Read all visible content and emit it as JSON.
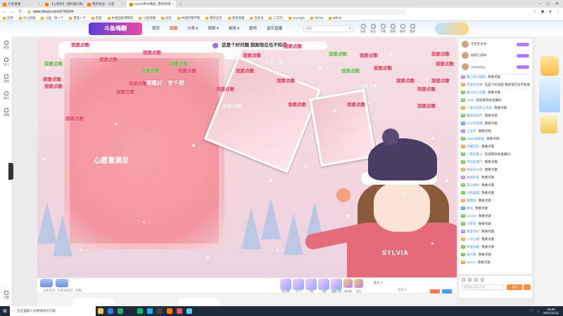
{
  "browser": {
    "tabs": [
      {
        "label": "斗鱼直播",
        "active": false
      },
      {
        "label": "【心愿单】(我的第1章)",
        "active": false
      },
      {
        "label": "我的关注 - 斗鱼",
        "active": false
      },
      {
        "label": "Sylvia希尔薇娅_我的频道",
        "active": true
      },
      {
        "label": "",
        "active": false
      }
    ],
    "url": "www.douyu.com/3742334",
    "bookmarks": [
      "应用",
      "九九金融",
      "斗鱼 - 每一个",
      "百度一下",
      "百度",
      "中国国家博物馆",
      "斗鱼直播",
      "抖音",
      "中国哔哩哔哩",
      "我的主页",
      "游戏直播",
      "已关注",
      "二次元",
      "YouTube",
      "TikTok",
      "Bilibili"
    ],
    "window_controls": [
      "–",
      "□",
      "✕"
    ]
  },
  "site": {
    "logo": "斗鱼嗨翻",
    "nav": [
      "首页",
      "直播",
      "分类 ▾",
      "视频 ▾",
      "游戏 ▾",
      "鱼吧",
      "音乐直播"
    ],
    "active_nav": "直播",
    "search_placeholder": "搜索",
    "header_icons": [
      "历史",
      "关注",
      "下载",
      "消息",
      "创作",
      "登录"
    ]
  },
  "sidebar": {
    "items": [
      "推荐",
      "关注",
      "游戏",
      "娱乐",
      "直播",
      "更多"
    ],
    "bottom": "设置"
  },
  "player": {
    "topic": "这是个好问题 我刚现在也不知道",
    "song": "嘟嘟好 - 李千郡",
    "card_text": "心愿意满足",
    "overlay_text": "SYLVIA"
  },
  "danmaku": [
    {
      "text": "我要点歌",
      "color": "red"
    },
    {
      "text": "我要点歌",
      "color": "red"
    },
    {
      "text": "我要点歌",
      "color": "red"
    },
    {
      "text": "我要点歌",
      "color": "red"
    },
    {
      "text": "我要点歌",
      "color": "green"
    },
    {
      "text": "我要点歌",
      "color": "red"
    },
    {
      "text": "我要点歌",
      "color": "red"
    },
    {
      "text": "我要点歌",
      "color": "red"
    },
    {
      "text": "我要点歌",
      "color": "red"
    },
    {
      "text": "我要点歌",
      "color": "green"
    },
    {
      "text": "我要点歌",
      "color": "red"
    },
    {
      "text": "我要点歌",
      "color": "red"
    },
    {
      "text": "我要点歌",
      "color": "red"
    },
    {
      "text": "我要点歌",
      "color": "green"
    },
    {
      "text": "我要点歌",
      "color": "red"
    },
    {
      "text": "我要点歌",
      "color": "red"
    },
    {
      "text": "我要点歌",
      "color": "red"
    },
    {
      "text": "我要点歌",
      "color": "red"
    },
    {
      "text": "我要点歌",
      "color": "green"
    },
    {
      "text": "我要点歌",
      "color": "red"
    },
    {
      "text": "我要点歌",
      "color": "white"
    },
    {
      "text": "我要点歌",
      "color": "white"
    },
    {
      "text": "我要点歌",
      "color": "red"
    },
    {
      "text": "我要点歌",
      "color": "red"
    },
    {
      "text": "我要点歌",
      "color": "red"
    },
    {
      "text": "我要点歌",
      "color": "red"
    },
    {
      "text": "我要点歌",
      "color": "white"
    },
    {
      "text": "我要点歌",
      "color": "red"
    },
    {
      "text": "我要点歌",
      "color": "red"
    },
    {
      "text": "我要点歌",
      "color": "red"
    },
    {
      "text": "我要点歌",
      "color": "green"
    },
    {
      "text": "我要点歌",
      "color": "red"
    }
  ],
  "toolbar": {
    "info": "立即关注 · 分享本房间 · 举报",
    "gifts": [
      "荧光棒",
      "办卡",
      "飞机",
      "火箭",
      "超级火箭",
      "穿云箭",
      "告白"
    ],
    "count_label": "鱼丸 0",
    "num_label": "鱼翅 0"
  },
  "rank": [
    {
      "name": "无名的冬咪"
    },
    {
      "name": "姑娘七娘咪"
    },
    {
      "name": "Yuanwhyy"
    }
  ],
  "chat": [
    {
      "lv": "20",
      "user": "暖心的小姐姐:",
      "msg": "我要点歌",
      "c": "p"
    },
    {
      "lv": "16",
      "user": "无名的冬咪:",
      "msg": "这是个好问题 我刚现在也不知道",
      "c": "o"
    },
    {
      "lv": "12",
      "user": "暖心的小可爱:",
      "msg": "我要点歌",
      "c": "g"
    },
    {
      "lv": "08",
      "user": "Yurin:",
      "msg": "欢迎来到本直播间",
      "c": "g"
    },
    {
      "lv": "21",
      "user": "一身白毛的小可爱:",
      "msg": "我要点歌",
      "c": "o"
    },
    {
      "lv": "15",
      "user": "路过的同学:",
      "msg": "我要点歌",
      "c": "g"
    },
    {
      "lv": "09",
      "user": "小小冰淇淋:",
      "msg": "我要点歌",
      "c": "b"
    },
    {
      "lv": "33",
      "user": "土豆子:",
      "msg": "我要点歌",
      "c": "p"
    },
    {
      "lv": "11",
      "user": "Sylvia的粉丝:",
      "msg": "我要点歌",
      "c": "g"
    },
    {
      "lv": "17",
      "user": "冰镇可乐:",
      "msg": "我要点歌",
      "c": "o"
    },
    {
      "lv": "22",
      "user": "一直在路上:",
      "msg": "欢迎来到本直播间",
      "c": "g"
    },
    {
      "lv": "05",
      "user": "不知名用户:",
      "msg": "我要点歌",
      "c": "g"
    },
    {
      "lv": "18",
      "user": "欢乐的小鱼:",
      "msg": "我要点歌",
      "c": "o"
    },
    {
      "lv": "26",
      "user": "好想吃饭:",
      "msg": "我要点歌",
      "c": "p"
    },
    {
      "lv": "14",
      "user": "开心就好:",
      "msg": "我要点歌",
      "c": "g"
    },
    {
      "lv": "07",
      "user": "大脸猫猫:",
      "msg": "我要点歌",
      "c": "g"
    },
    {
      "lv": "19",
      "user": "萌萌哒:",
      "msg": "我要点歌",
      "c": "o"
    },
    {
      "lv": "24",
      "user": "晚风:",
      "msg": "我要点歌",
      "c": "b"
    },
    {
      "lv": "10",
      "user": "Lemon:",
      "msg": "我要点歌",
      "c": "g"
    },
    {
      "lv": "13",
      "user": "小雪花:",
      "msg": "我要点歌",
      "c": "g"
    },
    {
      "lv": "28",
      "user": "星星点灯:",
      "msg": "我要点歌",
      "c": "p"
    },
    {
      "lv": "06",
      "user": "一只小鹿:",
      "msg": "我要点歌",
      "c": "o"
    },
    {
      "lv": "30",
      "user": "欢迎光临:",
      "msg": "我要点歌",
      "c": "g"
    },
    {
      "lv": "12",
      "user": "旅行者:",
      "msg": "我要点歌",
      "c": "g"
    },
    {
      "lv": "16",
      "user": "Momo:",
      "msg": "我要点歌",
      "c": "o"
    }
  ],
  "chat_input": {
    "placeholder": "这里输入聊天内容",
    "send_label": "发送"
  },
  "taskbar": {
    "search_placeholder": "在这里输入你要搜索的内容",
    "apps": [
      "file-explorer",
      "edge",
      "chrome",
      "steam",
      "wechat",
      "qq",
      "obs",
      "douyu",
      "music",
      "mail"
    ],
    "time": "18:00",
    "date": "2021/11/11"
  }
}
